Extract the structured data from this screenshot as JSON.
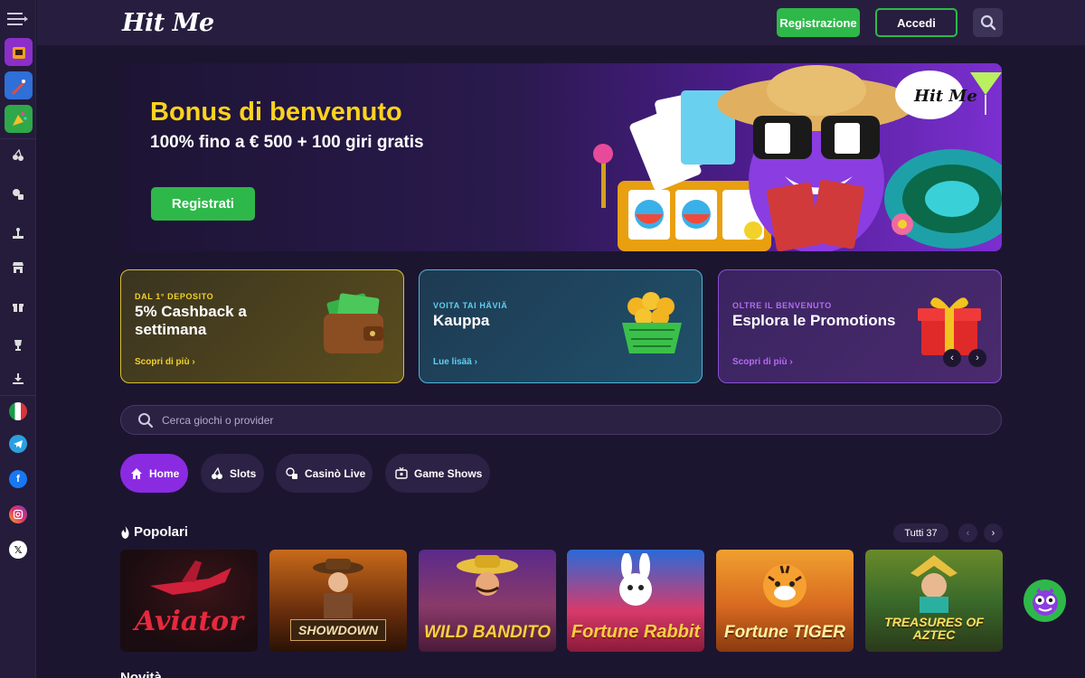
{
  "header": {
    "logo": "Hit Me",
    "register_label": "Registrazione",
    "login_label": "Accedi"
  },
  "sidebar": {
    "games": [
      "slot-machine-icon",
      "rocket-icon",
      "party-icon"
    ],
    "items": [
      "slots-icon",
      "casino-live-icon",
      "virtual-icon",
      "shop-icon",
      "gift-icon",
      "trophy-icon",
      "download-icon"
    ],
    "language": "it",
    "socials": [
      "telegram",
      "facebook",
      "instagram",
      "x"
    ]
  },
  "hero": {
    "title": "Bonus di benvenuto",
    "subtitle": "100% fino a € 500 + 100 giri gratis",
    "button": "Registrati",
    "art_badge": "Hit Me"
  },
  "promos": [
    {
      "kicker": "DAL 1° DEPOSITO",
      "title": "5% Cashback a settimana",
      "link": "Scopri di più ›",
      "accent": "#f2d22a"
    },
    {
      "kicker": "VOITA TAI HÄVIÄ",
      "title": "Kauppa",
      "link": "Lue lisää ›",
      "accent": "#5fd0f0"
    },
    {
      "kicker": "OLTRE IL BENVENUTO",
      "title": "Esplora le Promotions",
      "link": "Scopri di più ›",
      "accent": "#b46cf2"
    }
  ],
  "search": {
    "placeholder": "Cerca giochi o provider"
  },
  "tabs": [
    {
      "label": "Home",
      "icon": "home-icon",
      "active": true
    },
    {
      "label": "Slots",
      "icon": "cherries-icon",
      "active": false
    },
    {
      "label": "Casinò Live",
      "icon": "dice-icon",
      "active": false
    },
    {
      "label": "Game Shows",
      "icon": "tv-icon",
      "active": false
    }
  ],
  "popular": {
    "title": "Popolari",
    "all_label": "Tutti 37",
    "games": [
      {
        "name": "Aviator"
      },
      {
        "name": "SHOWDOWN"
      },
      {
        "name": "WILD BANDITO"
      },
      {
        "name": "Fortune Rabbit"
      },
      {
        "name": "Fortune TIGER"
      },
      {
        "name": "TREASURES OF AZTEC"
      }
    ]
  },
  "next_section": {
    "title": "Novità"
  }
}
